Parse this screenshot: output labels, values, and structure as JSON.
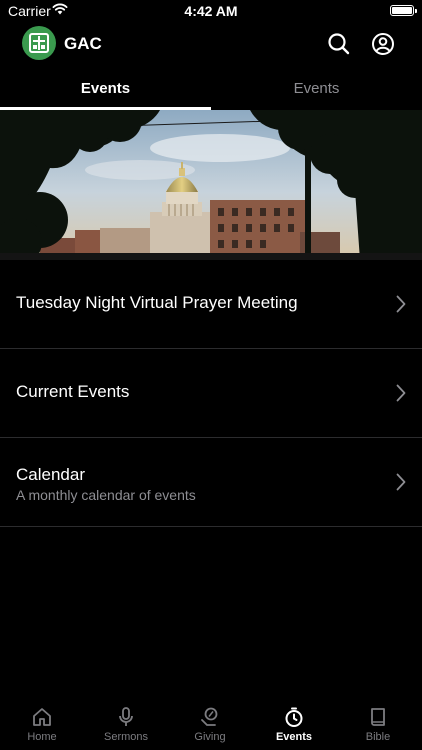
{
  "status_bar": {
    "carrier": "Carrier",
    "time": "4:42 AM"
  },
  "header": {
    "title": "GAC",
    "logo_color": "#3a9a4e"
  },
  "tabs": [
    {
      "label": "Events",
      "active": true
    },
    {
      "label": "Events",
      "active": false
    }
  ],
  "hero": {
    "description": "capitol dome photo"
  },
  "list": [
    {
      "title": "Tuesday Night Virtual Prayer Meeting",
      "subtitle": ""
    },
    {
      "title": "Current Events",
      "subtitle": ""
    },
    {
      "title": "Calendar",
      "subtitle": "A monthly calendar of events"
    }
  ],
  "tab_bar": [
    {
      "label": "Home",
      "icon": "home-icon",
      "active": false
    },
    {
      "label": "Sermons",
      "icon": "microphone-icon",
      "active": false
    },
    {
      "label": "Giving",
      "icon": "giving-icon",
      "active": false
    },
    {
      "label": "Events",
      "icon": "stopwatch-icon",
      "active": true
    },
    {
      "label": "Bible",
      "icon": "book-icon",
      "active": false
    }
  ],
  "colors": {
    "background": "#000000",
    "accent": "#ffffff",
    "muted": "#8e8e93",
    "separator": "#2c2c2e"
  }
}
